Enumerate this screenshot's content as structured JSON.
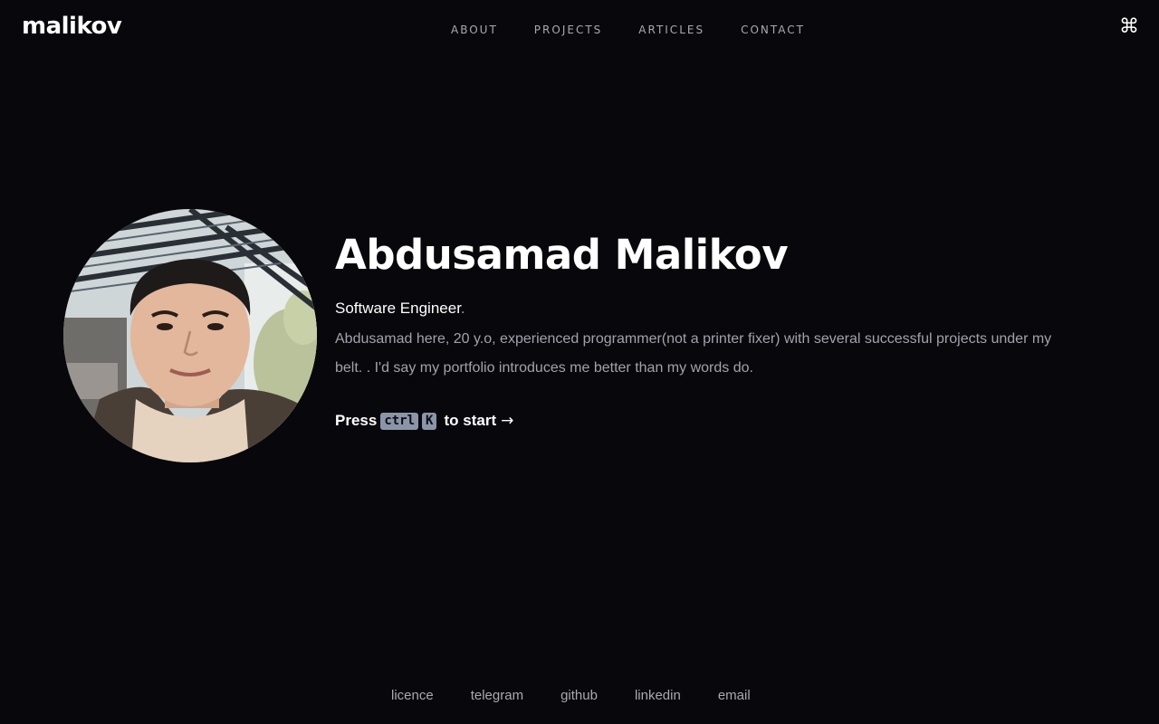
{
  "header": {
    "logo": "malikov",
    "nav": [
      "ABOUT",
      "PROJECTS",
      "ARTICLES",
      "CONTACT"
    ],
    "command_icon": "command-icon",
    "command_glyph": "⌘"
  },
  "hero": {
    "name": "Abdusamad Malikov",
    "role": "Software Engineer",
    "role_suffix": ".",
    "bio": "Abdusamad here, 20 y.o, experienced programmer(not a printer fixer) with several successful projects under my belt. . I'd say my portfolio introduces me better than my words do.",
    "press": "Press",
    "key1": "ctrl",
    "key2": "K",
    "to_start": "to start",
    "arrow": "→"
  },
  "footer": {
    "links": [
      "licence",
      "telegram",
      "github",
      "linkedin",
      "email"
    ]
  },
  "colors": {
    "background": "#08070b",
    "text": "#ffffff",
    "muted": "#a2a2ac",
    "kbd_bg": "#8a95a8"
  }
}
